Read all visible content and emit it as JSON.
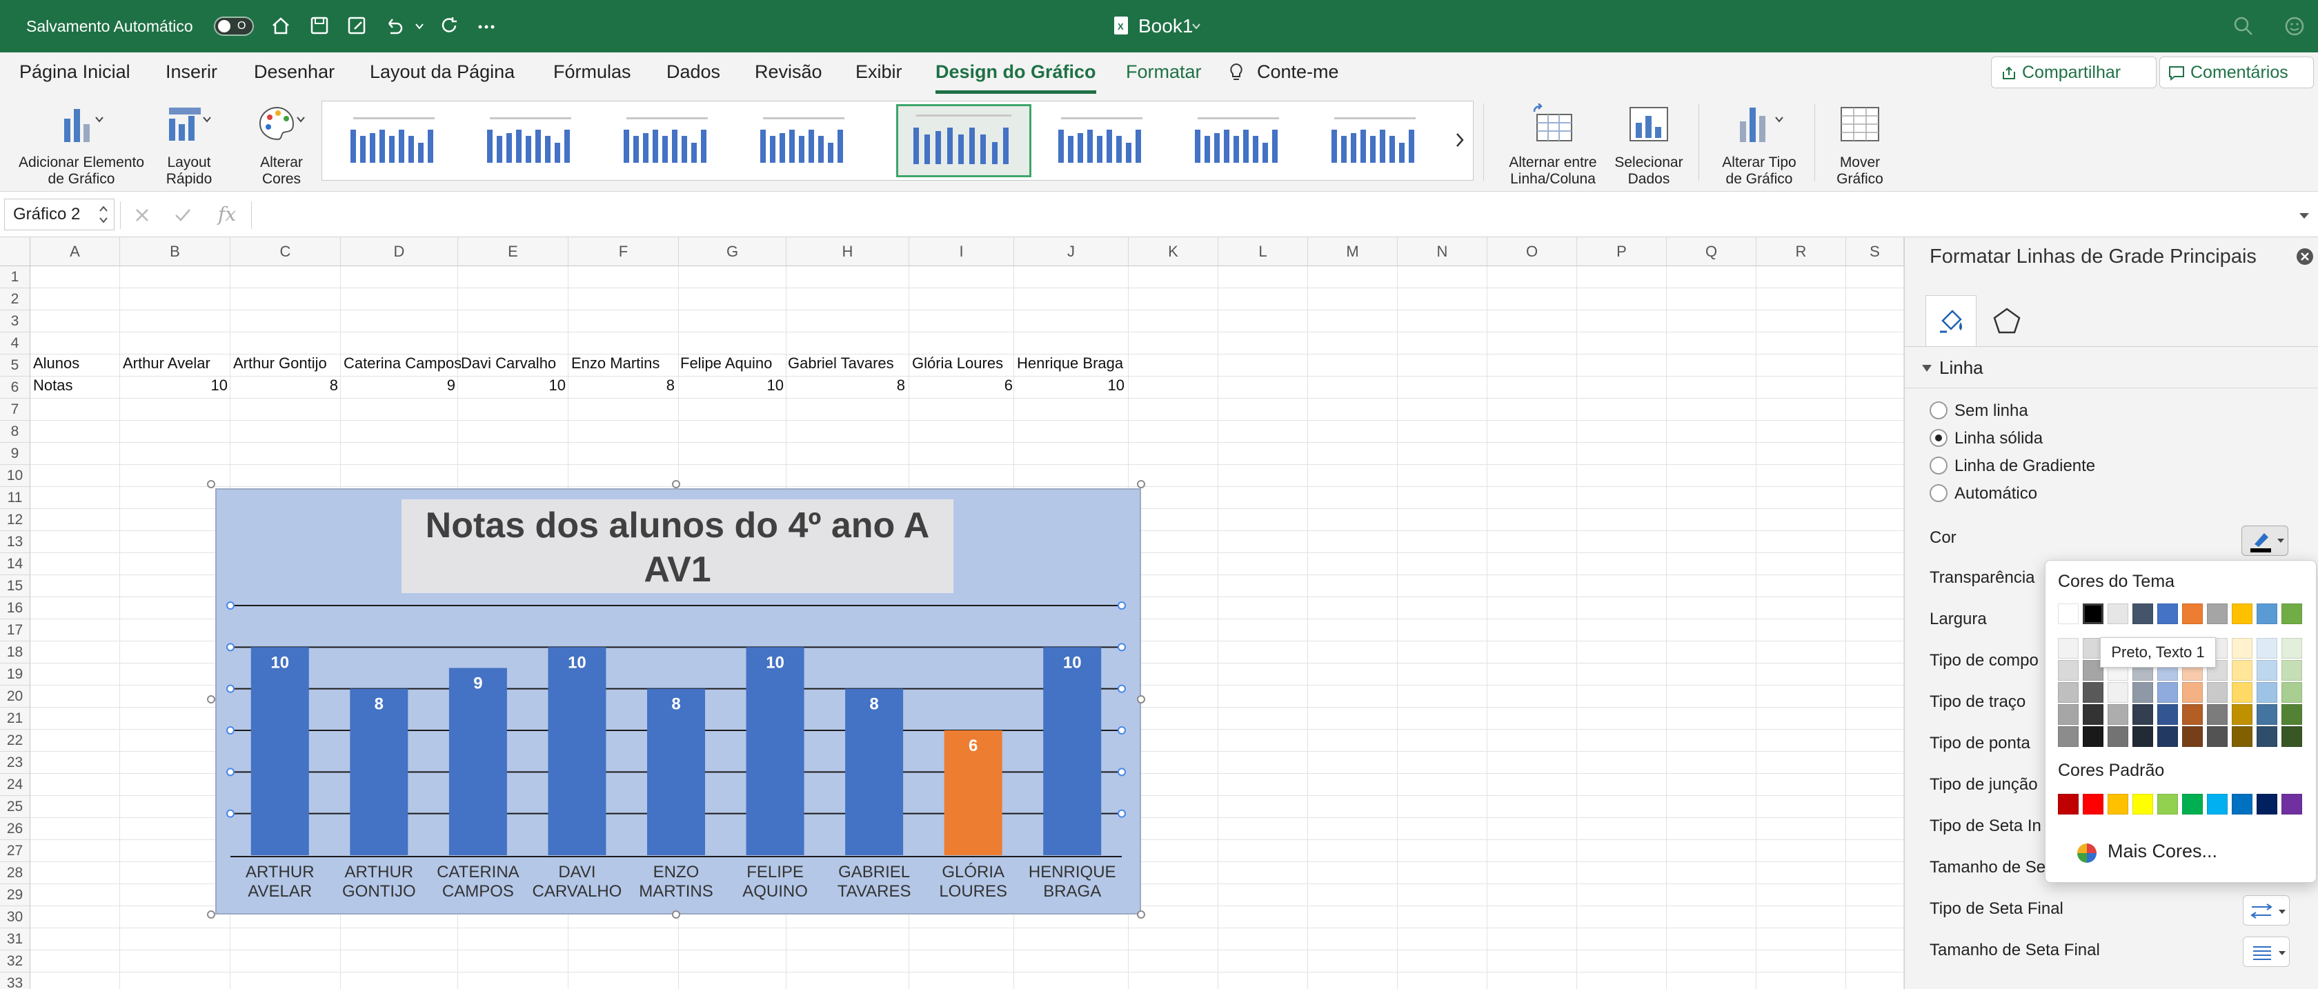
{
  "titlebar": {
    "autosave_label": "Salvamento Automático",
    "autosave_toggle": "O",
    "doc_title": "Book1"
  },
  "tabs": [
    "Página Inicial",
    "Inserir",
    "Desenhar",
    "Layout da Página",
    "Fórmulas",
    "Dados",
    "Revisão",
    "Exibir",
    "Design do Gráfico",
    "Formatar",
    "Conte-me"
  ],
  "share": {
    "share_label": "Compartilhar",
    "comments_label": "Comentários"
  },
  "ribbon": {
    "add_element": [
      "Adicionar Elemento",
      "de Gráfico"
    ],
    "quick_layout": [
      "Layout",
      "Rápido"
    ],
    "change_colors": [
      "Alterar",
      "Cores"
    ],
    "switch_row_col": [
      "Alternar entre",
      "Linha/Coluna"
    ],
    "select_data": [
      "Selecionar",
      "Dados"
    ],
    "change_type": [
      "Alterar Tipo",
      "de Gráfico"
    ],
    "move_chart": [
      "Mover",
      "Gráfico"
    ]
  },
  "formula": {
    "name_box": "Gráfico 2",
    "fx_label": "fx"
  },
  "grid": {
    "columns": [
      "A",
      "B",
      "C",
      "D",
      "E",
      "F",
      "G",
      "H",
      "I",
      "J",
      "K",
      "L",
      "M",
      "N",
      "O",
      "P",
      "Q",
      "R",
      "S"
    ],
    "rows": [
      "1",
      "2",
      "3",
      "4",
      "5",
      "6",
      "7",
      "8",
      "9",
      "10",
      "11",
      "12",
      "13",
      "14",
      "15",
      "16",
      "17",
      "18",
      "19",
      "20",
      "21",
      "22",
      "23",
      "24",
      "25",
      "26",
      "27",
      "28",
      "29",
      "30",
      "31",
      "32",
      "33"
    ],
    "row5": [
      "Alunos",
      "Arthur Avelar",
      "Arthur Gontijo",
      "Caterina Campos",
      "Davi Carvalho",
      "Enzo Martins",
      "Felipe Aquino",
      "Gabriel Tavares",
      "Glória Loures",
      "Henrique Braga"
    ],
    "row6_label": "Notas",
    "row6_values": [
      "10",
      "8",
      "9",
      "10",
      "8",
      "10",
      "8",
      "6",
      "10"
    ]
  },
  "chart_data": {
    "type": "bar",
    "title": "Notas dos alunos do 4º ano A AV1",
    "title_lines": [
      "Notas dos alunos do 4º ano A",
      "AV1"
    ],
    "categories": [
      "ARTHUR AVELAR",
      "ARTHUR GONTIJO",
      "CATERINA CAMPOS",
      "DAVI CARVALHO",
      "ENZO MARTINS",
      "FELIPE AQUINO",
      "GABRIEL TAVARES",
      "GLÓRIA LOURES",
      "HENRIQUE BRAGA"
    ],
    "category_lines": [
      [
        "ARTHUR",
        "AVELAR"
      ],
      [
        "ARTHUR",
        "GONTIJO"
      ],
      [
        "CATERINA",
        "CAMPOS"
      ],
      [
        "DAVI",
        "CARVALHO"
      ],
      [
        "ENZO",
        "MARTINS"
      ],
      [
        "FELIPE",
        "AQUINO"
      ],
      [
        "GABRIEL",
        "TAVARES"
      ],
      [
        "GLÓRIA",
        "LOURES"
      ],
      [
        "HENRIQUE",
        "BRAGA"
      ]
    ],
    "values": [
      10,
      8,
      9,
      10,
      8,
      10,
      8,
      6,
      10
    ],
    "labels": [
      "10",
      "8",
      "9",
      "10",
      "8",
      "10",
      "8",
      "6",
      "10"
    ],
    "ylim": [
      0,
      12
    ],
    "gridlines": true,
    "highlight_index": 7,
    "colors": {
      "bar": "#4472c4",
      "highlight": "#ed7d31",
      "plot_bg": "#b4c7e7",
      "gridline": "#1a1a1a"
    }
  },
  "panel": {
    "title": "Formatar Linhas de Grade Principais",
    "section": "Linha",
    "line_options": [
      "Sem linha",
      "Linha sólida",
      "Linha de Gradiente",
      "Automático"
    ],
    "selected_option": 1,
    "props": [
      "Cor",
      "Transparência",
      "Largura",
      "Tipo de compo",
      "Tipo de traço",
      "Tipo de ponta",
      "Tipo de junção",
      "Tipo de Seta In",
      "Tamanho de Se",
      "Tipo de Seta Final",
      "Tamanho de Seta Final"
    ]
  },
  "color_picker": {
    "theme_title": "Cores do Tema",
    "standard_title": "Cores Padrão",
    "more_colors": "Mais Cores...",
    "tooltip": "Preto, Texto 1",
    "theme_colors": [
      "#ffffff",
      "#000000",
      "#e7e6e6",
      "#44546a",
      "#4472c4",
      "#ed7d31",
      "#a5a5a5",
      "#ffc000",
      "#5b9bd5",
      "#70ad47"
    ],
    "standard_colors": [
      "#c00000",
      "#ff0000",
      "#ffc000",
      "#ffff00",
      "#92d050",
      "#00b050",
      "#00b0f0",
      "#0070c0",
      "#002060",
      "#7030a0"
    ]
  }
}
